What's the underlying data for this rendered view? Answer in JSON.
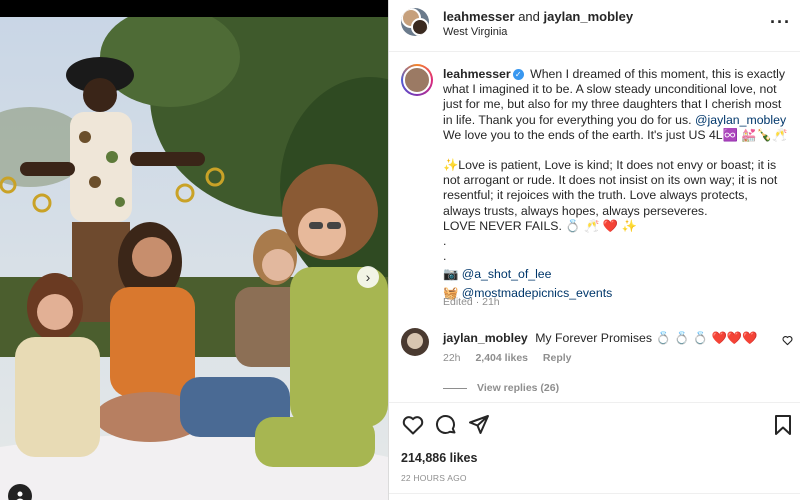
{
  "header": {
    "user1": "leahmesser",
    "joiner": "and",
    "user2": "jaylan_mobley",
    "location": "West Virginia",
    "more_icon": "more-horizontal-icon"
  },
  "caption": {
    "username": "leahmesser",
    "text_1": "When I dreamed of this moment, this is exactly what I imagined it to be. A slow steady unconditional love, not just for me, but also for my three daughters that I cherish most in life. Thank you for everything you do for us.",
    "mention": "@jaylan_mobley",
    "text_2": "We love you to the ends of the earth. It's just US 4L♾️ 💒🍾🥂",
    "para_2": "✨Love is patient, Love is kind; It does not envy or boast; it is not arrogant or rude. It does not insist on its own way; it is not resentful; it rejoices with the truth. Love always protects, always trusts, always hopes, always perseveres.",
    "para_3": "LOVE NEVER FAILS. 💍 🥂 ❤️ ✨",
    "dot": ".",
    "credit_1_icon": "📷",
    "credit_1": "@a_shot_of_lee",
    "credit_2_icon": "🧺",
    "credit_2": "@mostmadepicnics_events",
    "edited": "Edited · 21h"
  },
  "comment": {
    "username": "jaylan_mobley",
    "text": "My Forever Promises 💍 💍 💍 ❤️❤️❤️",
    "time": "22h",
    "likes": "2,404 likes",
    "reply": "Reply",
    "view_replies": "View replies (26)"
  },
  "footer": {
    "likes": "214,886 likes",
    "posted": "22 HOURS AGO"
  },
  "colors": {
    "verified": "#3897f0",
    "mention": "#00376b",
    "muted": "#8e8e8e"
  }
}
